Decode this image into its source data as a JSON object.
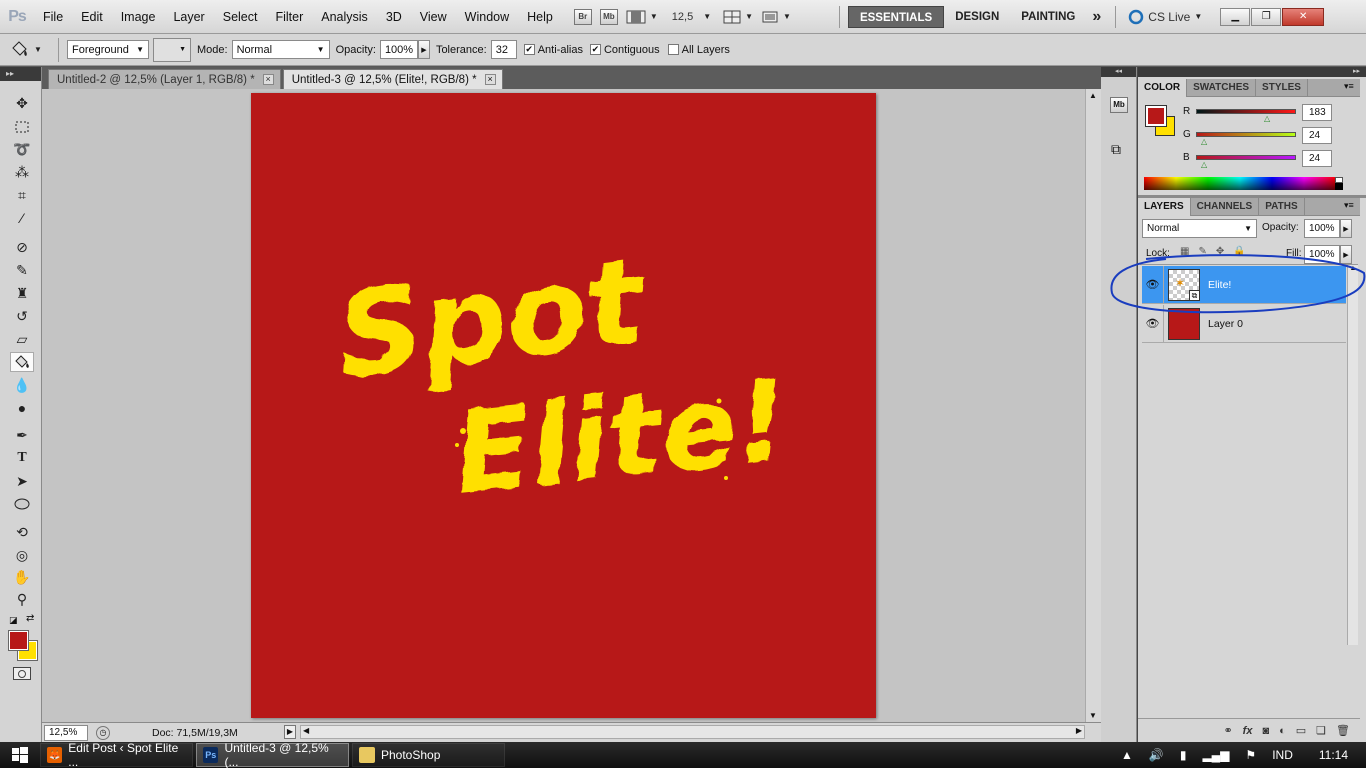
{
  "app": {
    "logo": "Ps",
    "menu": [
      "File",
      "Edit",
      "Image",
      "Layer",
      "Select",
      "Filter",
      "Analysis",
      "3D",
      "View",
      "Window",
      "Help"
    ],
    "bridge_label": "Br",
    "minibridge_label": "Mb",
    "zoom_value": "12,5",
    "workspaces": [
      "ESSENTIALS",
      "DESIGN",
      "PAINTING"
    ],
    "active_workspace": "ESSENTIALS",
    "more_workspaces": "»",
    "cs_live": "CS Live"
  },
  "options": {
    "fill_source": "Foreground",
    "mode_label": "Mode:",
    "mode_value": "Normal",
    "opacity_label": "Opacity:",
    "opacity_value": "100%",
    "tolerance_label": "Tolerance:",
    "tolerance_value": "32",
    "anti_alias_label": "Anti-alias",
    "anti_alias_checked": true,
    "contiguous_label": "Contiguous",
    "contiguous_checked": true,
    "all_layers_label": "All Layers",
    "all_layers_checked": false
  },
  "tools": {
    "active": "paint-bucket-tool",
    "foreground_color": "#b71818",
    "background_color": "#ffe000"
  },
  "documents": {
    "tabs": [
      {
        "label": "Untitled-2 @ 12,5% (Layer 1, RGB/8) *",
        "active": false
      },
      {
        "label": "Untitled-3 @ 12,5% (Elite!, RGB/8) *",
        "active": true
      }
    ],
    "canvas_background": "#b71818",
    "artwork_text": {
      "line1": "Spot",
      "line2": "Elite!",
      "color": "#ffe000"
    }
  },
  "status": {
    "zoom": "12,5%",
    "doc_size": "Doc: 71,5M/19,3M"
  },
  "color_panel": {
    "tabs": [
      "COLOR",
      "SWATCHES",
      "STYLES"
    ],
    "active_tab": "COLOR",
    "r_label": "R",
    "r": "183",
    "g_label": "G",
    "g": "24",
    "b_label": "B",
    "b": "24",
    "foreground": "#b71818",
    "background": "#ffe000"
  },
  "layers_panel": {
    "tabs": [
      "LAYERS",
      "CHANNELS",
      "PATHS"
    ],
    "active_tab": "LAYERS",
    "blend_mode": "Normal",
    "opacity_label": "Opacity:",
    "opacity_value": "100%",
    "lock_label": "Lock:",
    "fill_label": "Fill:",
    "fill_value": "100%",
    "layers": [
      {
        "name": "Elite!",
        "selected": true,
        "visible": true
      },
      {
        "name": "Layer 0",
        "selected": false,
        "visible": true
      }
    ],
    "selection_color": "#3c96f0",
    "annotation_color": "#1a3dbf"
  },
  "taskbar": {
    "items": [
      {
        "label": "Edit Post ‹ Spot Elite ...",
        "icon": "firefox-icon",
        "active": false
      },
      {
        "label": "Untitled-3 @ 12,5% (...",
        "icon": "photoshop-icon",
        "active": true
      },
      {
        "label": "PhotoShop",
        "icon": "folder-icon",
        "active": false
      }
    ],
    "language": "IND",
    "time": "11:14"
  }
}
